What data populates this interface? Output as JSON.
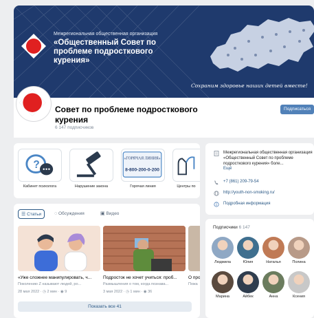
{
  "cover": {
    "org_type": "Межрегиональная общественная организация",
    "org_name": "«Общественный Совет по проблеме подросткового курения»",
    "slogan": "Сохраним здоровье наших детей вместе!"
  },
  "group": {
    "title": "Совет по проблеме подросткового курения",
    "subscribers": "6 147 подписчиков",
    "subscribe_label": "Подписаться"
  },
  "links": [
    {
      "label": "Кабинет психолога",
      "icon": "chat-bubbles-icon"
    },
    {
      "label": "Нарушение закона",
      "icon": "gavel-icon"
    },
    {
      "label": "Горячая линия",
      "icon": "hotline-card-icon",
      "card_title": "«ГОРЯЧАЯ ЛИНИЯ»",
      "card_phone": "8-800-200-0-200"
    },
    {
      "label": "Центры по",
      "icon": "hands-icon"
    }
  ],
  "info": {
    "description": "Межрегиональная общественная организация «Общественный Совет по проблеме подросткового курения» боле...",
    "more": "Ещё",
    "phone": "+7 (861) 209-79-54",
    "site": "http://youth-non-smoking.ru/",
    "details": "Подробная информация"
  },
  "members": {
    "title": "Подписчики",
    "count": "6 147",
    "people": [
      {
        "name": "Людмила",
        "color": "#8fa8c4"
      },
      {
        "name": "Юлия",
        "color": "#3f6f8f"
      },
      {
        "name": "Наталья",
        "color": "#c07a55"
      },
      {
        "name": "Полина",
        "color": "#b89a88"
      },
      {
        "name": "Марина",
        "color": "#5a4a3e"
      },
      {
        "name": "Айбек",
        "color": "#2f3d4e"
      },
      {
        "name": "Анна",
        "color": "#6b7c5e"
      },
      {
        "name": "Ксения",
        "color": "#c8c8c8"
      }
    ]
  },
  "articles": {
    "tabs": [
      {
        "label": "Статьи",
        "icon": "article-icon"
      },
      {
        "label": "Обсуждения",
        "icon": "comment-icon"
      },
      {
        "label": "Видео",
        "icon": "video-icon"
      }
    ],
    "items": [
      {
        "title": "«Уже сложнее манипулировать, ч...",
        "sub": "Поколению Z называют людей, ро...",
        "date": "28 мая 2022",
        "time": "2 мин",
        "views": "9"
      },
      {
        "title": "Подросток не хочет учиться: проб...",
        "sub": "Размышления о том, когда познава...",
        "date": "3 мая 2022",
        "time": "1 мин",
        "views": "36"
      },
      {
        "title": "О про",
        "sub": "Пожа",
        "date": "",
        "time": "",
        "views": ""
      }
    ],
    "show_all": "Показать все 41"
  },
  "colors": {
    "accent": "#5181b8",
    "cover": "#1f3a6d",
    "logo_red": "#e02020"
  }
}
